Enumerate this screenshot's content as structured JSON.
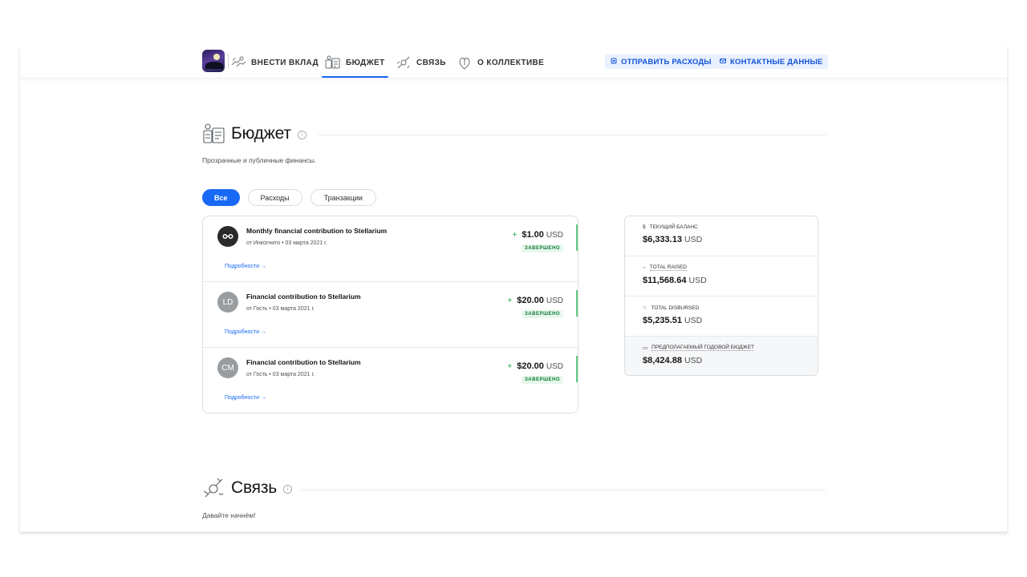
{
  "nav": {
    "items": [
      {
        "label": "Внести вклад",
        "icon": "hands-icon"
      },
      {
        "label": "Бюджет",
        "icon": "budget-icon"
      },
      {
        "label": "Связь",
        "icon": "connect-icon"
      },
      {
        "label": "О коллективе",
        "icon": "about-icon"
      }
    ],
    "actions": [
      {
        "label": "Отправить расходы",
        "icon": "receipt-icon"
      },
      {
        "label": "Контактные данные",
        "icon": "mail-icon"
      }
    ]
  },
  "budget": {
    "title": "Бюджет",
    "description": "Прозрачные и публичные финансы.",
    "tabs": [
      "Все",
      "Расходы",
      "Транзакции"
    ],
    "transactions": [
      {
        "avatar": "",
        "title": "Monthly financial contribution to Stellarium",
        "meta": "от Инкогнито • 03 марта 2021 г.",
        "sign": "+",
        "amount": "$1.00",
        "currency": "USD",
        "status": "ЗАВЕРШЕНО",
        "details": "Подробности →"
      },
      {
        "avatar": "LD",
        "title": "Financial contribution to Stellarium",
        "meta": "от Гость • 03 марта 2021 г.",
        "sign": "+",
        "amount": "$20.00",
        "currency": "USD",
        "status": "ЗАВЕРШЕНО",
        "details": "Подробности →"
      },
      {
        "avatar": "CM",
        "title": "Financial contribution to Stellarium",
        "meta": "от Гость • 03 марта 2021 г.",
        "sign": "+",
        "amount": "$20.00",
        "currency": "USD",
        "status": "ЗАВЕРШЕНО",
        "details": "Подробности →"
      }
    ],
    "balances": [
      {
        "icon": "$",
        "label": "Текущий баланс",
        "amount": "$6,333.13",
        "currency": "USD"
      },
      {
        "icon": "~",
        "label": "Total raised",
        "amount": "$11,568.64",
        "currency": "USD"
      },
      {
        "icon": "⁙",
        "label": "Total disbursed",
        "amount": "$5,235.51",
        "currency": "USD"
      },
      {
        "icon": "▭",
        "label": "Предполагаемый годовой бюджет",
        "amount": "$8,424.88",
        "currency": "USD"
      }
    ]
  },
  "connect": {
    "title": "Связь",
    "description": "Давайте начнём!"
  },
  "colors": {
    "accent": "#1869f5",
    "success": "#16a34a"
  }
}
